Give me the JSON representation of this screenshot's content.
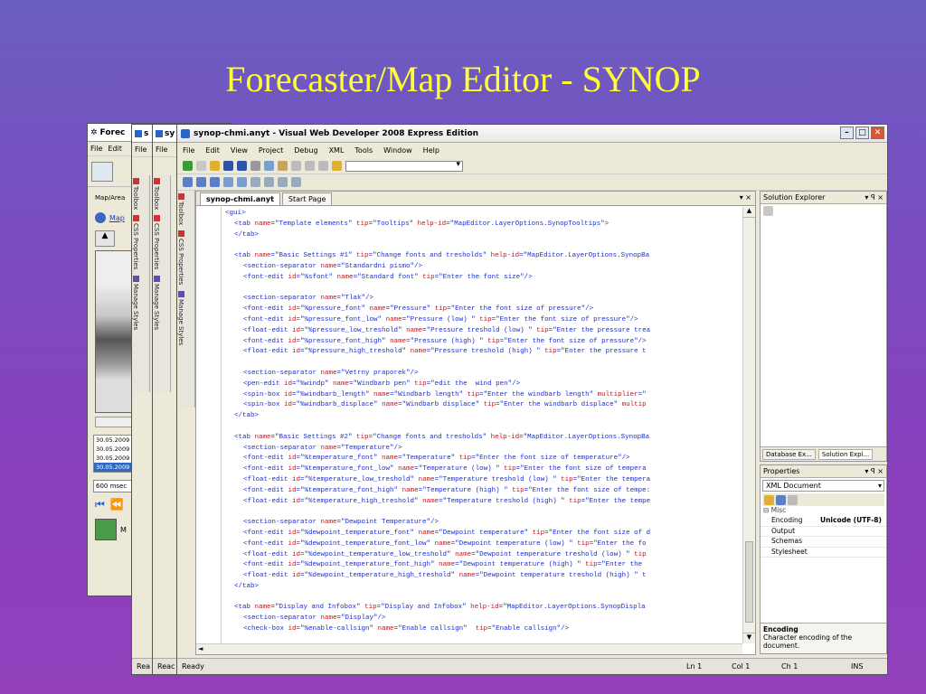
{
  "slide": {
    "title": "Forecaster/Map Editor - SYNOP"
  },
  "back_windows": {
    "forecaster": {
      "title": "Forec",
      "menu": [
        "File",
        "Edit"
      ],
      "label_map_area": "Map/Area",
      "label_map_link": "Map",
      "timestamps": [
        "30.05.2009",
        "30.05.2009",
        "30.05.2009",
        "30.05.2009"
      ],
      "interval": "600 msec",
      "status_partial": "M"
    },
    "win2": {
      "title": "s",
      "menu": "File",
      "status": "Rea"
    },
    "win3": {
      "title": "sy",
      "menu": "File",
      "status": "Reac"
    },
    "side_tabs": [
      "Toolbox",
      "CSS Properties",
      "Manage Styles"
    ]
  },
  "vwd": {
    "title": "synop-chmi.anyt - Visual Web Developer 2008 Express Edition",
    "menu": [
      "File",
      "Edit",
      "View",
      "Project",
      "Debug",
      "XML",
      "Tools",
      "Window",
      "Help"
    ],
    "doc_tabs": [
      "synop-chmi.anyt",
      "Start Page"
    ],
    "doc_controls": "▾ ×",
    "code_lines": [
      {
        "ind": 0,
        "parts": [
          [
            "t",
            "<gui>"
          ]
        ]
      },
      {
        "ind": 1,
        "parts": [
          [
            "t",
            "<tab "
          ],
          [
            "a",
            "name"
          ],
          [
            "t",
            "=\"Template elements\" "
          ],
          [
            "a",
            "tip"
          ],
          [
            "t",
            "=\"Tooltips\" "
          ],
          [
            "a",
            "help-id"
          ],
          [
            "t",
            "=\"MapEditor.LayerOptions.SynopTooltips\">"
          ]
        ]
      },
      {
        "ind": 1,
        "parts": [
          [
            "t",
            "</tab>"
          ]
        ]
      },
      {
        "ind": 0,
        "parts": []
      },
      {
        "ind": 1,
        "parts": [
          [
            "t",
            "<tab "
          ],
          [
            "a",
            "name"
          ],
          [
            "t",
            "=\"Basic Settings #1\" "
          ],
          [
            "a",
            "tip"
          ],
          [
            "t",
            "=\"Change fonts and tresholds\" "
          ],
          [
            "a",
            "help-id"
          ],
          [
            "t",
            "=\"MapEditor.LayerOptions.SynopBa"
          ]
        ]
      },
      {
        "ind": 2,
        "parts": [
          [
            "t",
            "<section-separator "
          ],
          [
            "a",
            "name"
          ],
          [
            "t",
            "=\"Standardni pismo\"/>"
          ]
        ]
      },
      {
        "ind": 2,
        "parts": [
          [
            "t",
            "<font-edit "
          ],
          [
            "a",
            "id"
          ],
          [
            "t",
            "=\"%sfont\" "
          ],
          [
            "a",
            "name"
          ],
          [
            "t",
            "=\"Standard font\" "
          ],
          [
            "a",
            "tip"
          ],
          [
            "t",
            "=\"Enter the font size\"/>"
          ]
        ]
      },
      {
        "ind": 0,
        "parts": []
      },
      {
        "ind": 2,
        "parts": [
          [
            "t",
            "<section-separator "
          ],
          [
            "a",
            "name"
          ],
          [
            "t",
            "=\"Tlak\"/>"
          ]
        ]
      },
      {
        "ind": 2,
        "parts": [
          [
            "t",
            "<font-edit "
          ],
          [
            "a",
            "id"
          ],
          [
            "t",
            "=\"%pressure_font\" "
          ],
          [
            "a",
            "name"
          ],
          [
            "t",
            "=\"Pressure\" "
          ],
          [
            "a",
            "tip"
          ],
          [
            "t",
            "=\"Enter the font size of pressure\"/>"
          ]
        ]
      },
      {
        "ind": 2,
        "parts": [
          [
            "t",
            "<font-edit "
          ],
          [
            "a",
            "id"
          ],
          [
            "t",
            "=\"%pressure_font_low\" "
          ],
          [
            "a",
            "name"
          ],
          [
            "t",
            "=\"Pressure (low) \" "
          ],
          [
            "a",
            "tip"
          ],
          [
            "t",
            "=\"Enter the font size of pressure\"/>"
          ]
        ]
      },
      {
        "ind": 2,
        "parts": [
          [
            "t",
            "<float-edit "
          ],
          [
            "a",
            "id"
          ],
          [
            "t",
            "=\"%pressure_low_treshold\" "
          ],
          [
            "a",
            "name"
          ],
          [
            "t",
            "=\"Pressure treshold (low) \" "
          ],
          [
            "a",
            "tip"
          ],
          [
            "t",
            "=\"Enter the pressure trea"
          ]
        ]
      },
      {
        "ind": 2,
        "parts": [
          [
            "t",
            "<font-edit "
          ],
          [
            "a",
            "id"
          ],
          [
            "t",
            "=\"%pressure_font_high\" "
          ],
          [
            "a",
            "name"
          ],
          [
            "t",
            "=\"Pressure (high) \" "
          ],
          [
            "a",
            "tip"
          ],
          [
            "t",
            "=\"Enter the font size of pressure\"/>"
          ]
        ]
      },
      {
        "ind": 2,
        "parts": [
          [
            "t",
            "<float-edit "
          ],
          [
            "a",
            "id"
          ],
          [
            "t",
            "=\"%pressure_high_treshold\" "
          ],
          [
            "a",
            "name"
          ],
          [
            "t",
            "=\"Pressure treshold (high) \" "
          ],
          [
            "a",
            "tip"
          ],
          [
            "t",
            "=\"Enter the pressure t"
          ]
        ]
      },
      {
        "ind": 0,
        "parts": []
      },
      {
        "ind": 2,
        "parts": [
          [
            "t",
            "<section-separator "
          ],
          [
            "a",
            "name"
          ],
          [
            "t",
            "=\"Vetrny praporek\"/>"
          ]
        ]
      },
      {
        "ind": 2,
        "parts": [
          [
            "t",
            "<pen-edit "
          ],
          [
            "a",
            "id"
          ],
          [
            "t",
            "=\"%windp\" "
          ],
          [
            "a",
            "name"
          ],
          [
            "t",
            "=\"Windbarb pen\" "
          ],
          [
            "a",
            "tip"
          ],
          [
            "t",
            "=\"edit the  wind pen\"/>"
          ]
        ]
      },
      {
        "ind": 2,
        "parts": [
          [
            "t",
            "<spin-box "
          ],
          [
            "a",
            "id"
          ],
          [
            "t",
            "=\"%windbarb_length\" "
          ],
          [
            "a",
            "name"
          ],
          [
            "t",
            "=\"Windbarb length\" "
          ],
          [
            "a",
            "tip"
          ],
          [
            "t",
            "=\"Enter the windbarb length\" "
          ],
          [
            "a",
            "multiplier"
          ],
          [
            "t",
            "=\""
          ]
        ]
      },
      {
        "ind": 2,
        "parts": [
          [
            "t",
            "<spin-box "
          ],
          [
            "a",
            "id"
          ],
          [
            "t",
            "=\"%windbarb_displace\" "
          ],
          [
            "a",
            "name"
          ],
          [
            "t",
            "=\"Windbarb displace\" "
          ],
          [
            "a",
            "tip"
          ],
          [
            "t",
            "=\"Enter the windbarb displace\" "
          ],
          [
            "a",
            "multip"
          ]
        ]
      },
      {
        "ind": 1,
        "parts": [
          [
            "t",
            "</tab>"
          ]
        ]
      },
      {
        "ind": 0,
        "parts": []
      },
      {
        "ind": 1,
        "parts": [
          [
            "t",
            "<tab "
          ],
          [
            "a",
            "name"
          ],
          [
            "t",
            "=\"Basic Settings #2\" "
          ],
          [
            "a",
            "tip"
          ],
          [
            "t",
            "=\"Change fonts and tresholds\" "
          ],
          [
            "a",
            "help-id"
          ],
          [
            "t",
            "=\"MapEditor.LayerOptions.SynopBa"
          ]
        ]
      },
      {
        "ind": 2,
        "parts": [
          [
            "t",
            "<section-separator "
          ],
          [
            "a",
            "name"
          ],
          [
            "t",
            "=\"Temperature\"/>"
          ]
        ]
      },
      {
        "ind": 2,
        "parts": [
          [
            "t",
            "<font-edit "
          ],
          [
            "a",
            "id"
          ],
          [
            "t",
            "=\"%temperature_font\" "
          ],
          [
            "a",
            "name"
          ],
          [
            "t",
            "=\"Temperature\" "
          ],
          [
            "a",
            "tip"
          ],
          [
            "t",
            "=\"Enter the font size of temperature\"/>"
          ]
        ]
      },
      {
        "ind": 2,
        "parts": [
          [
            "t",
            "<font-edit "
          ],
          [
            "a",
            "id"
          ],
          [
            "t",
            "=\"%temperature_font_low\" "
          ],
          [
            "a",
            "name"
          ],
          [
            "t",
            "=\"Temperature (low) \" "
          ],
          [
            "a",
            "tip"
          ],
          [
            "t",
            "=\"Enter the font size of tempera"
          ]
        ]
      },
      {
        "ind": 2,
        "parts": [
          [
            "t",
            "<float-edit "
          ],
          [
            "a",
            "id"
          ],
          [
            "t",
            "=\"%temperature_low_treshold\" "
          ],
          [
            "a",
            "name"
          ],
          [
            "t",
            "=\"Temperature treshold (low) \" "
          ],
          [
            "a",
            "tip"
          ],
          [
            "t",
            "=\"Enter the tempera"
          ]
        ]
      },
      {
        "ind": 2,
        "parts": [
          [
            "t",
            "<font-edit "
          ],
          [
            "a",
            "id"
          ],
          [
            "t",
            "=\"%temperature_font_high\" "
          ],
          [
            "a",
            "name"
          ],
          [
            "t",
            "=\"Temperature (high) \" "
          ],
          [
            "a",
            "tip"
          ],
          [
            "t",
            "=\"Enter the font size of tempe:"
          ]
        ]
      },
      {
        "ind": 2,
        "parts": [
          [
            "t",
            "<float-edit "
          ],
          [
            "a",
            "id"
          ],
          [
            "t",
            "=\"%temperature_high_treshold\" "
          ],
          [
            "a",
            "name"
          ],
          [
            "t",
            "=\"Temperature treshold (high) \" "
          ],
          [
            "a",
            "tip"
          ],
          [
            "t",
            "=\"Enter the tempe"
          ]
        ]
      },
      {
        "ind": 0,
        "parts": []
      },
      {
        "ind": 2,
        "parts": [
          [
            "t",
            "<section-separator "
          ],
          [
            "a",
            "name"
          ],
          [
            "t",
            "=\"Dewpoint Temperature\"/>"
          ]
        ]
      },
      {
        "ind": 2,
        "parts": [
          [
            "t",
            "<font-edit "
          ],
          [
            "a",
            "id"
          ],
          [
            "t",
            "=\"%dewpoint_temperature_font\" "
          ],
          [
            "a",
            "name"
          ],
          [
            "t",
            "=\"Dewpoint temperature\" "
          ],
          [
            "a",
            "tip"
          ],
          [
            "t",
            "=\"Enter the font size of d"
          ]
        ]
      },
      {
        "ind": 2,
        "parts": [
          [
            "t",
            "<font-edit "
          ],
          [
            "a",
            "id"
          ],
          [
            "t",
            "=\"%dewpoint_temperature_font_low\" "
          ],
          [
            "a",
            "name"
          ],
          [
            "t",
            "=\"Dewpoint temperature (low) \" "
          ],
          [
            "a",
            "tip"
          ],
          [
            "t",
            "=\"Enter the fo"
          ]
        ]
      },
      {
        "ind": 2,
        "parts": [
          [
            "t",
            "<float-edit "
          ],
          [
            "a",
            "id"
          ],
          [
            "t",
            "=\"%dewpoint_temperature_low_treshold\" "
          ],
          [
            "a",
            "name"
          ],
          [
            "t",
            "=\"Dewpoint temperature treshold (low) \" "
          ],
          [
            "a",
            "tip"
          ]
        ]
      },
      {
        "ind": 2,
        "parts": [
          [
            "t",
            "<font-edit "
          ],
          [
            "a",
            "id"
          ],
          [
            "t",
            "=\"%dewpoint_temperature_font_high\" "
          ],
          [
            "a",
            "name"
          ],
          [
            "t",
            "=\"Dewpoint temperature (high) \" "
          ],
          [
            "a",
            "tip"
          ],
          [
            "t",
            "=\"Enter the"
          ]
        ]
      },
      {
        "ind": 2,
        "parts": [
          [
            "t",
            "<float-edit "
          ],
          [
            "a",
            "id"
          ],
          [
            "t",
            "=\"%dewpoint_temperature_high_treshold\" "
          ],
          [
            "a",
            "name"
          ],
          [
            "t",
            "=\"Dewpoint temperature treshold (high) \" t"
          ]
        ]
      },
      {
        "ind": 1,
        "parts": [
          [
            "t",
            "</tab>"
          ]
        ]
      },
      {
        "ind": 0,
        "parts": []
      },
      {
        "ind": 1,
        "parts": [
          [
            "t",
            "<tab "
          ],
          [
            "a",
            "name"
          ],
          [
            "t",
            "=\"Display and Infobox\" "
          ],
          [
            "a",
            "tip"
          ],
          [
            "t",
            "=\"Display and Infobox\" "
          ],
          [
            "a",
            "help-id"
          ],
          [
            "t",
            "=\"MapEditor.LayerOptions.SynopDispla"
          ]
        ]
      },
      {
        "ind": 2,
        "parts": [
          [
            "t",
            "<section-separator "
          ],
          [
            "a",
            "name"
          ],
          [
            "t",
            "=\"Display\"/>"
          ]
        ]
      },
      {
        "ind": 2,
        "parts": [
          [
            "t",
            "<check-box "
          ],
          [
            "a",
            "id"
          ],
          [
            "t",
            "=\"%enable-callsign\" "
          ],
          [
            "a",
            "name"
          ],
          [
            "t",
            "=\"Enable callsign\"  "
          ],
          [
            "a",
            "tip"
          ],
          [
            "t",
            "=\"Enable callsign\"/>"
          ]
        ]
      }
    ],
    "solution_explorer": {
      "title": "Solution Explorer",
      "controls": "▾ ꟼ ×",
      "tabs": [
        "Database Ex...",
        "Solution Expl..."
      ]
    },
    "properties": {
      "title": "Properties",
      "controls": "▾ ꟼ ×",
      "selected": "XML Document",
      "category": "Misc",
      "rows": [
        {
          "k": "Encoding",
          "v": "Unicode (UTF-8)"
        },
        {
          "k": "Output",
          "v": ""
        },
        {
          "k": "Schemas",
          "v": ""
        },
        {
          "k": "Stylesheet",
          "v": ""
        }
      ],
      "desc_title": "Encoding",
      "desc_text": "Character encoding of the document."
    },
    "status": {
      "ready": "Ready",
      "ln": "Ln 1",
      "col": "Col 1",
      "ch": "Ch 1",
      "ins": "INS"
    }
  }
}
